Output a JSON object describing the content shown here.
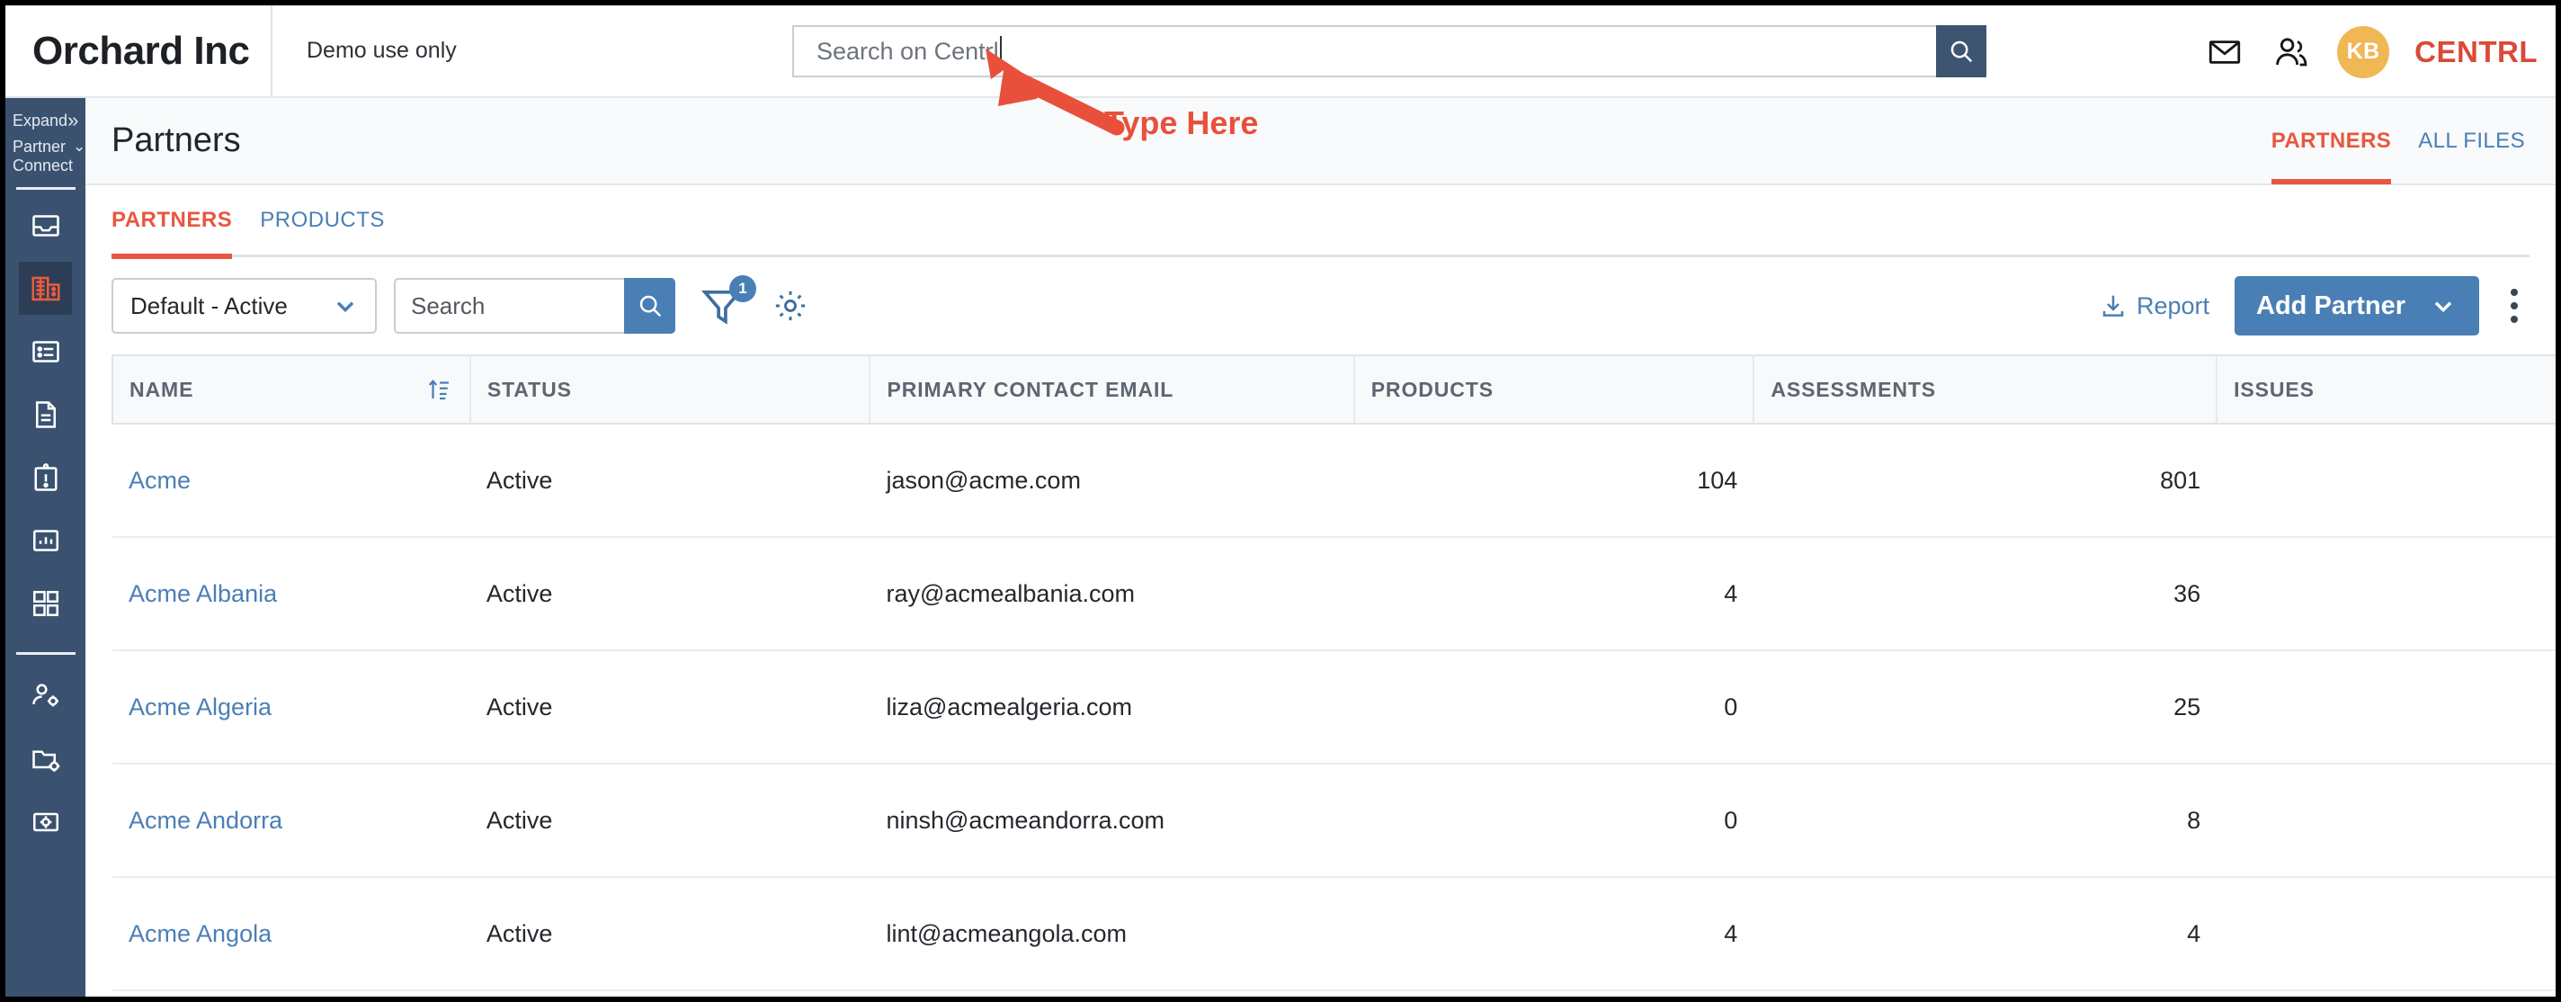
{
  "header": {
    "brand_title": "Orchard Inc",
    "demo_note": "Demo use only",
    "search_placeholder": "Search on Centrl",
    "search_value": "",
    "mail_icon": "envelope-icon",
    "people_icon": "people-icon",
    "avatar_initials": "KB",
    "product_logo": "CENTRL"
  },
  "sidebar": {
    "expand_label": "Expand",
    "section_line1": "Partner",
    "section_line2": "Connect",
    "items": [
      {
        "icon": "inbox-icon",
        "active": false
      },
      {
        "icon": "building-icon",
        "active": true
      },
      {
        "icon": "list-icon",
        "active": false
      },
      {
        "icon": "document-icon",
        "active": false
      },
      {
        "icon": "clipboard-alert-icon",
        "active": false
      },
      {
        "icon": "bar-chart-icon",
        "active": false
      },
      {
        "icon": "grid-apps-icon",
        "active": false
      }
    ],
    "bottom_items": [
      {
        "icon": "user-settings-icon"
      },
      {
        "icon": "folder-settings-icon"
      },
      {
        "icon": "settings-box-icon"
      }
    ]
  },
  "page": {
    "title": "Partners",
    "top_tabs": [
      {
        "label": "PARTNERS",
        "active": true
      },
      {
        "label": "ALL FILES",
        "active": false
      }
    ],
    "sub_tabs": [
      {
        "label": "PARTNERS",
        "active": true
      },
      {
        "label": "PRODUCTS",
        "active": false
      }
    ]
  },
  "toolbar": {
    "view_select_value": "Default - Active",
    "search_placeholder": "Search",
    "search_value": "",
    "filter_icon": "filter-icon",
    "filter_badge": "1",
    "gear_icon": "gear-icon",
    "report_label": "Report",
    "report_icon": "download-icon",
    "add_partner_label": "Add Partner",
    "kebab_icon": "more-vertical-icon"
  },
  "table": {
    "columns": [
      {
        "key": "name",
        "label": "NAME",
        "sortable": true,
        "sort_icon": "sort-ascending-icon"
      },
      {
        "key": "status",
        "label": "STATUS"
      },
      {
        "key": "email",
        "label": "PRIMARY CONTACT EMAIL"
      },
      {
        "key": "products",
        "label": "PRODUCTS"
      },
      {
        "key": "assessments",
        "label": "ASSESSMENTS"
      },
      {
        "key": "issues",
        "label": "ISSUES"
      }
    ],
    "rows": [
      {
        "name": "Acme",
        "status": "Active",
        "email": "jason@acme.com",
        "products": "104",
        "assessments": "801"
      },
      {
        "name": "Acme Albania",
        "status": "Active",
        "email": "ray@acmealbania.com",
        "products": "4",
        "assessments": "36"
      },
      {
        "name": "Acme Algeria",
        "status": "Active",
        "email": "liza@acmealgeria.com",
        "products": "0",
        "assessments": "25"
      },
      {
        "name": "Acme Andorra",
        "status": "Active",
        "email": "ninsh@acmeandorra.com",
        "products": "0",
        "assessments": "8"
      },
      {
        "name": "Acme Angola",
        "status": "Active",
        "email": "lint@acmeangola.com",
        "products": "4",
        "assessments": "4"
      }
    ]
  },
  "annotation": {
    "text": "Type Here",
    "color": "#e8503c"
  },
  "colors": {
    "sidebar_bg": "#3a5270",
    "accent_orange": "#e8573f",
    "accent_blue": "#4a7fb5",
    "header_btn": "#3d5570",
    "avatar_bg": "#f0b755"
  }
}
